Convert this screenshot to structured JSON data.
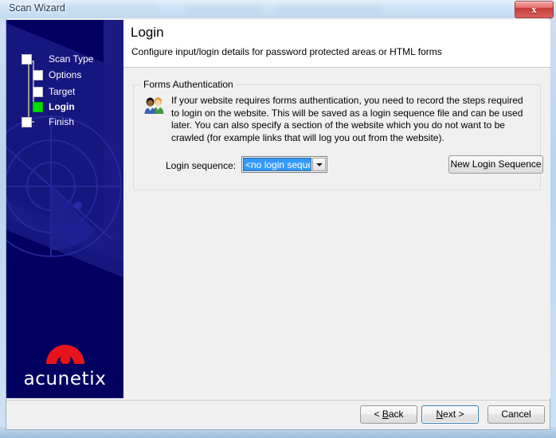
{
  "window": {
    "title": "Scan Wizard",
    "close_label": "x",
    "close_icon": "close-icon"
  },
  "sidebar": {
    "steps": [
      {
        "label": "Scan Type",
        "active": false
      },
      {
        "label": "Options",
        "active": false
      },
      {
        "label": "Target",
        "active": false
      },
      {
        "label": "Login",
        "active": true
      },
      {
        "label": "Finish",
        "active": false
      }
    ],
    "logo": {
      "wordmark": "acunetix",
      "mark_icon": "acunetix-arch-logo",
      "mark_color": "#e8141b"
    },
    "background_color": "#000060",
    "accent_color": "#1a1a85",
    "active_step_color": "#00e000"
  },
  "header": {
    "title": "Login",
    "subtitle": "Configure input/login details for password protected areas or HTML forms"
  },
  "forms_authentication": {
    "group_label": "Forms Authentication",
    "icon": "users-icon",
    "description": "If your website requires forms authentication, you need to record the steps required to login on the website. This will be saved as a login sequence file and can be used later.\nYou can also specify a section of the website which you do not want to be crawled (for example links that will log you out from the website).",
    "login_sequence_label": "Login sequence:",
    "login_sequence_value": "<no login sequence>",
    "login_sequence_selection_color": "#3399ff",
    "dropdown_icon": "chevron-down-icon",
    "new_login_sequence_label": "New Login Sequence"
  },
  "footer": {
    "back_label": "< Back",
    "back_mnemonic": "B",
    "next_label": "Next >",
    "next_mnemonic": "N",
    "cancel_label": "Cancel",
    "default_button": "next"
  }
}
